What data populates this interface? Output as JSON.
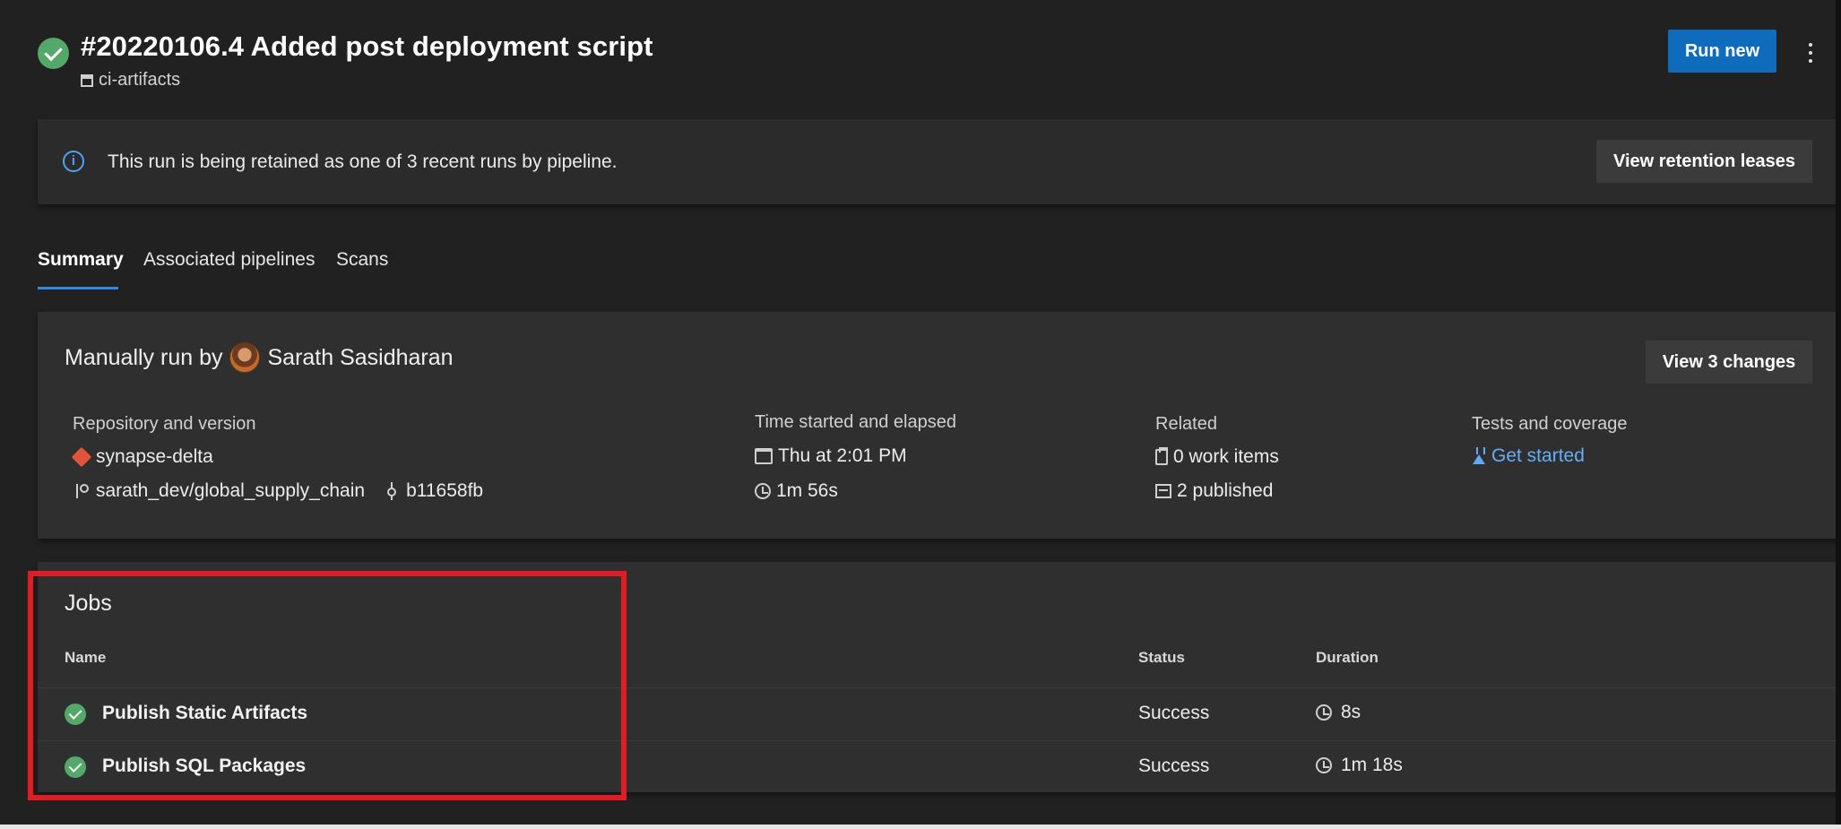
{
  "header": {
    "run_title": "#20220106.4 Added post deployment script",
    "pipeline_name": "ci-artifacts",
    "run_new_label": "Run new",
    "more_label": "⋮"
  },
  "banner": {
    "info_glyph": "i",
    "message": "This run is being retained as one of 3 recent runs by pipeline.",
    "button_label": "View retention leases"
  },
  "tabs": [
    {
      "label": "Summary",
      "active": true
    },
    {
      "label": "Associated pipelines",
      "active": false
    },
    {
      "label": "Scans",
      "active": false
    }
  ],
  "summary": {
    "run_by_prefix": "Manually run by",
    "run_by_name": "Sarath Sasidharan",
    "view_changes_label": "View 3 changes",
    "repository": {
      "heading": "Repository and version",
      "repo": "synapse-delta",
      "branch": "sarath_dev/global_supply_chain",
      "commit": "b11658fb"
    },
    "time": {
      "heading": "Time started and elapsed",
      "started": "Thu at 2:01 PM",
      "elapsed": "1m 56s"
    },
    "related": {
      "heading": "Related",
      "work_items": "0 work items",
      "published": "2 published"
    },
    "tests": {
      "heading": "Tests and coverage",
      "link": "Get started"
    }
  },
  "jobs": {
    "title": "Jobs",
    "columns": {
      "name": "Name",
      "status": "Status",
      "duration": "Duration"
    },
    "rows": [
      {
        "name": "Publish Static Artifacts",
        "status": "Success",
        "duration": "8s"
      },
      {
        "name": "Publish SQL Packages",
        "status": "Success",
        "duration": "1m 18s"
      }
    ]
  },
  "colors": {
    "background": "#212121",
    "card": "#2f2f2f",
    "success": "#54a86a",
    "primary_button": "#0f6cbd",
    "link": "#66aef5",
    "highlight": "#e31c23"
  }
}
